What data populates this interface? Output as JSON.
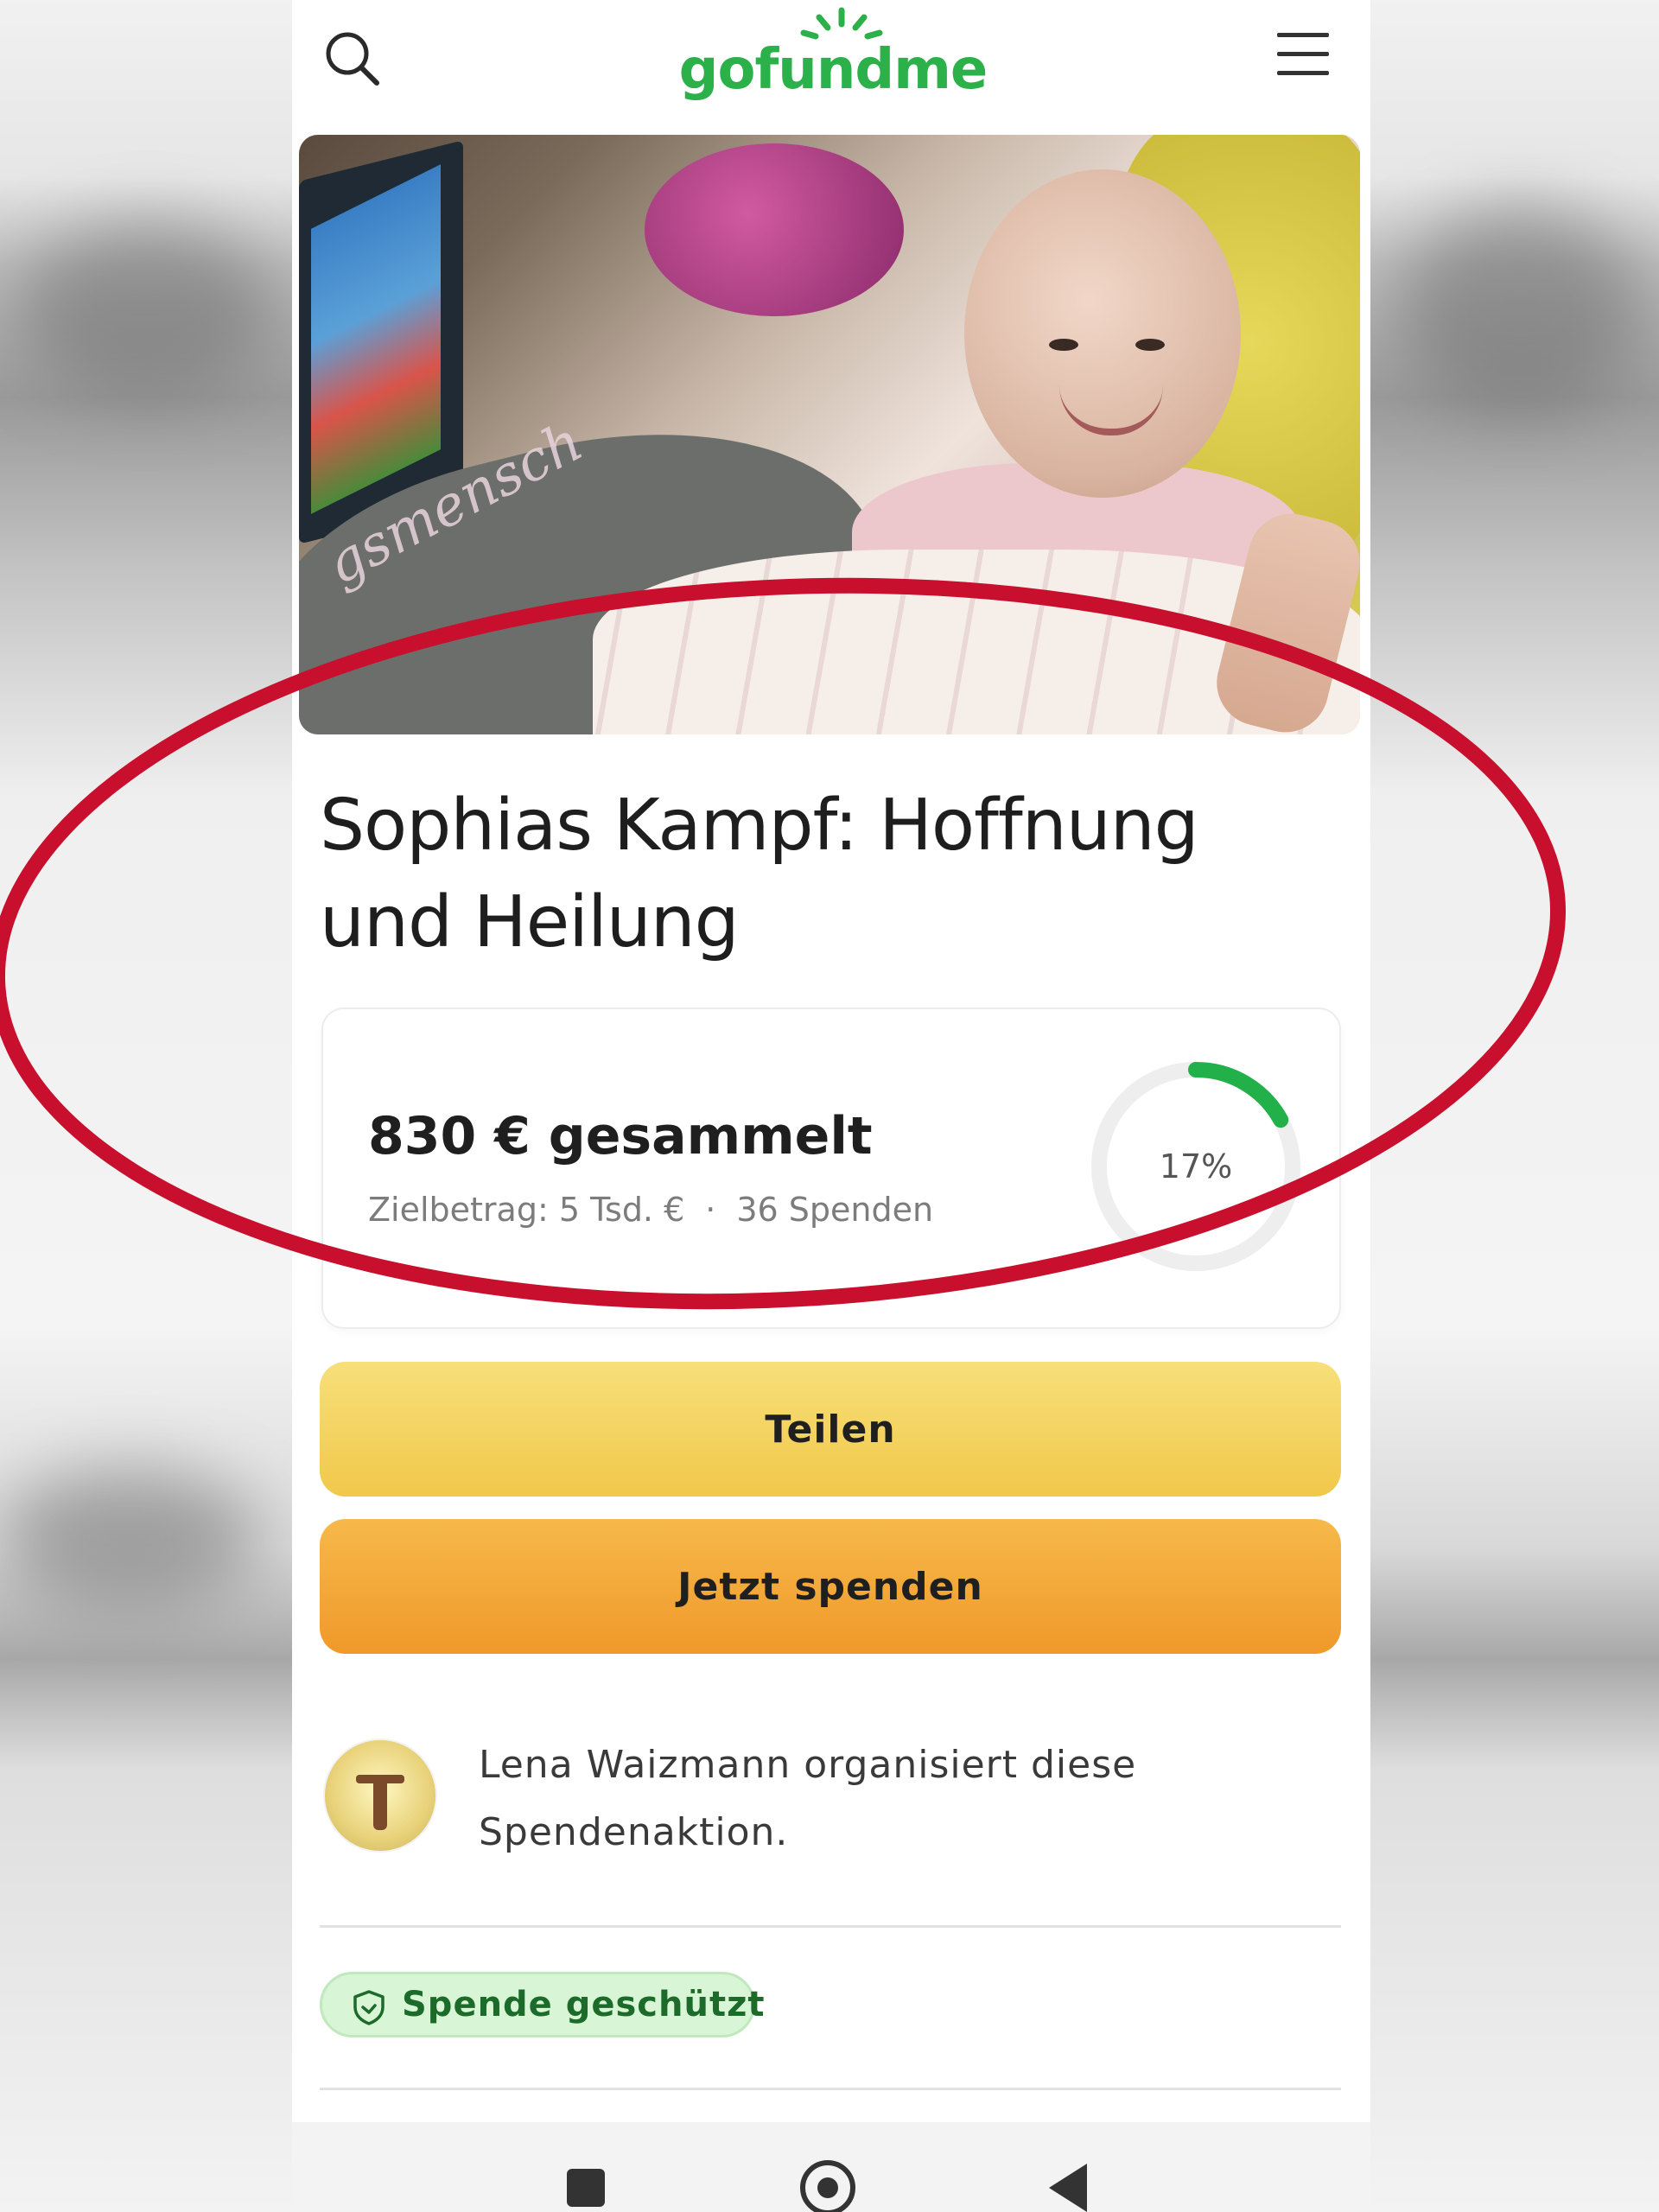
{
  "header": {
    "logo_text": "gofundme"
  },
  "campaign": {
    "title": "Sophias Kampf: Hoffnung und Heilung",
    "image_overlay_text": "gsmensch",
    "raised_text": "830 € gesammelt",
    "goal_text": "Zielbetrag: 5 Tsd. €",
    "separator": "·",
    "donations_text": "36 Spenden",
    "progress_label": "17%",
    "progress_fraction": 0.17
  },
  "actions": {
    "share_label": "Teilen",
    "donate_label": "Jetzt spenden"
  },
  "organizer": {
    "text": "Lena Waizmann organisiert diese Spendenaktion."
  },
  "badge": {
    "label": "Spende geschützt"
  },
  "colors": {
    "brand_green": "#2bb04a",
    "share_yellow": "#f3ce5a",
    "donate_orange": "#f2a232",
    "annotation_red": "#c8102e",
    "progress_green": "#22b04a"
  },
  "icons": {
    "search": "search-icon",
    "menu": "menu-icon",
    "shield": "shield-icon",
    "nav_recent": "recent-apps-icon",
    "nav_home": "home-icon",
    "nav_back": "back-icon"
  }
}
